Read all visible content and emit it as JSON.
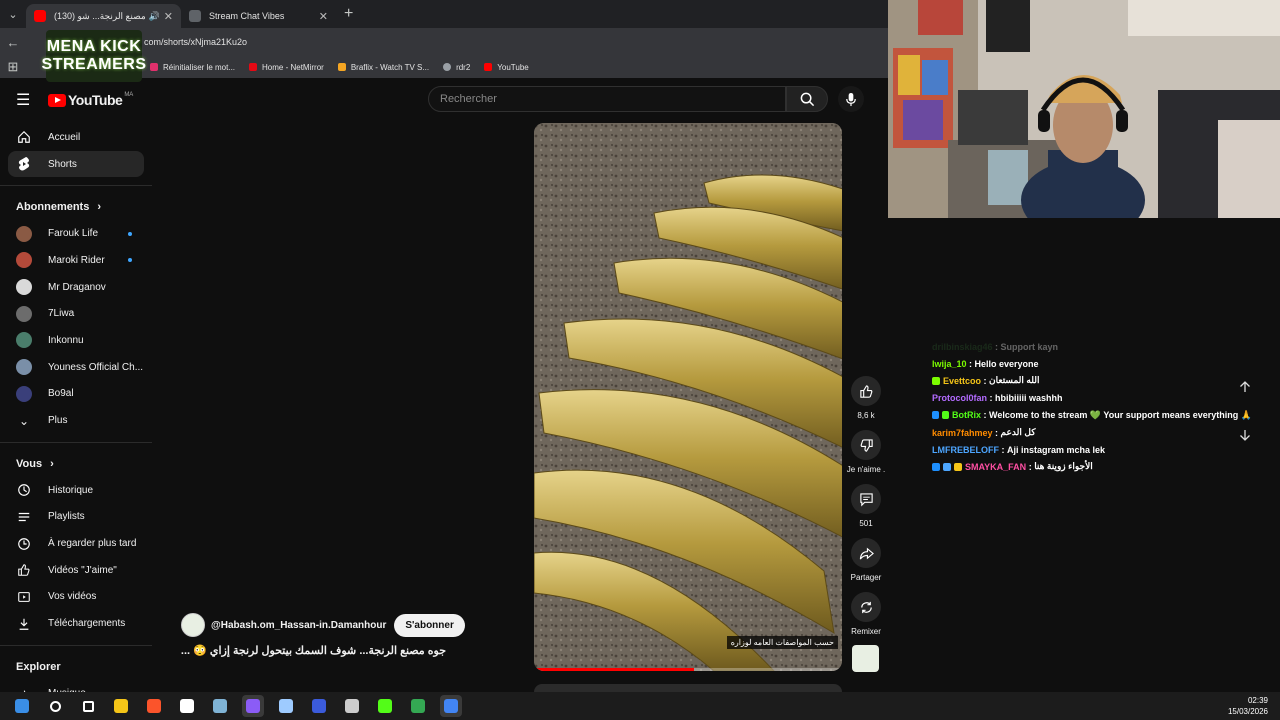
{
  "browser": {
    "tabs": [
      {
        "title": "(130) جوه مصنع الرنجة... شو",
        "active": true,
        "favicon_color": "#ff0000"
      },
      {
        "title": "Stream Chat Vibes",
        "active": false,
        "favicon_color": "#5f6368"
      }
    ],
    "new_tab_label": "+",
    "url": "com/shorts/xNjma21Ku2o",
    "bookmarks": [
      {
        "label": "Réinitialiser le mot...",
        "color": "#e1306c"
      },
      {
        "label": "Home - NetMirror",
        "color": "#e50914"
      },
      {
        "label": "Braflix - Watch TV S...",
        "color": "#f5a623"
      },
      {
        "label": "rdr2",
        "color": "#9aa0a6"
      },
      {
        "label": "YouTube",
        "color": "#ff0000"
      }
    ]
  },
  "overlay_logo": {
    "line1": "MENA KICK",
    "line2": "STREAMERS"
  },
  "youtube": {
    "logo_text": "YouTube",
    "country_code": "MA",
    "search_placeholder": "Rechercher"
  },
  "sidebar": {
    "main_items": [
      {
        "label": "Accueil",
        "icon": "home-icon",
        "active": false
      },
      {
        "label": "Shorts",
        "icon": "shorts-icon",
        "active": true
      }
    ],
    "subscriptions_title": "Abonnements",
    "subscriptions": [
      {
        "label": "Farouk Life",
        "avatar_color": "#8a5a44",
        "new": true
      },
      {
        "label": "Maroki Rider",
        "avatar_color": "#b44a3a",
        "new": true
      },
      {
        "label": "Mr Draganov",
        "avatar_color": "#d9d9d9",
        "new": false
      },
      {
        "label": "7Liwa",
        "avatar_color": "#6c6c6c",
        "new": false
      },
      {
        "label": "Inkonnu",
        "avatar_color": "#4a7d6b",
        "new": false
      },
      {
        "label": "Youness Official Ch...",
        "avatar_color": "#7a8fa8",
        "new": false
      },
      {
        "label": "Bo9al",
        "avatar_color": "#3a3f7a",
        "new": false
      },
      {
        "label": "Plus",
        "icon": "chevron-down-icon"
      }
    ],
    "you_title": "Vous",
    "you_items": [
      {
        "label": "Historique",
        "icon": "history-icon"
      },
      {
        "label": "Playlists",
        "icon": "playlists-icon"
      },
      {
        "label": "À regarder plus tard",
        "icon": "watch-later-icon"
      },
      {
        "label": "Vidéos \"J'aime\"",
        "icon": "like-icon"
      },
      {
        "label": "Vos vidéos",
        "icon": "your-videos-icon"
      },
      {
        "label": "Téléchargements",
        "icon": "download-icon"
      }
    ],
    "explore_title": "Explorer",
    "explore_items": [
      {
        "label": "Musique",
        "icon": "music-icon"
      }
    ]
  },
  "short": {
    "channel": "@Habash.om_Hassan-in.Damanhour",
    "subscribe_label": "S'abonner",
    "title": "جوه مصنع الرنجة... شوف السمك بيتحول لرنجة إزاي 😳 ...",
    "caption": "حسب المواصفات العامه لوزاره",
    "progress_fraction": 0.52,
    "actions": [
      {
        "label": "8,6 k",
        "icon": "thumbs-up-icon"
      },
      {
        "label": "Je n'aime .",
        "icon": "thumbs-down-icon"
      },
      {
        "label": "501",
        "icon": "comment-icon"
      },
      {
        "label": "Partager",
        "icon": "share-icon"
      },
      {
        "label": "Remixer",
        "icon": "remix-icon"
      }
    ]
  },
  "chat": {
    "messages": [
      {
        "user": "drilbinskiag46",
        "text": "Support kayn",
        "color": "#2d5a2d",
        "faded": true,
        "badges": []
      },
      {
        "user": "lwija_10",
        "text": "Hello everyone",
        "color": "#7cfc00",
        "faded": false,
        "badges": []
      },
      {
        "user": "Evettcoo",
        "text": "الله المستعان",
        "color": "#f5c518",
        "faded": false,
        "badges": [
          "#7cfc00"
        ]
      },
      {
        "user": "Protocol0fan",
        "text": "hbibiiiii washhh",
        "color": "#b36bff",
        "faded": false,
        "badges": []
      },
      {
        "user": "BotRix",
        "text": "Welcome to the stream 💚 Your support means everything 🙏",
        "color": "#53fc18",
        "faded": false,
        "badges": [
          "#1e90ff",
          "#53fc18"
        ]
      },
      {
        "user": "karim7fahmey",
        "text": "كل الدعم",
        "color": "#ff8c00",
        "faded": false,
        "badges": []
      },
      {
        "user": "LMFREBELOFF",
        "text": "Aji instagram mcha lek",
        "color": "#4da6ff",
        "faded": false,
        "badges": []
      },
      {
        "user": "SMAYKA_FAN",
        "text": "الأجواء زوينة هنا",
        "color": "#ff4fa3",
        "faded": false,
        "badges": [
          "#1e90ff",
          "#4da6ff",
          "#f5c518"
        ]
      }
    ]
  },
  "taskbar": {
    "time": "02:39",
    "date": "15/03/2026",
    "apps": [
      {
        "name": "windows-start-icon",
        "color": "#3a8ee6"
      },
      {
        "name": "search-icon",
        "color": "#ffffff"
      },
      {
        "name": "task-view-icon",
        "color": "#ffffff"
      },
      {
        "name": "file-explorer-icon",
        "color": "#f5c518"
      },
      {
        "name": "brave-icon",
        "color": "#fb542b"
      },
      {
        "name": "store-icon",
        "color": "#ffffff"
      },
      {
        "name": "app-icon",
        "color": "#7fb3d5"
      },
      {
        "name": "discord-icon",
        "color": "#8b5cf6"
      },
      {
        "name": "notepad-icon",
        "color": "#9ecbff"
      },
      {
        "name": "app-blue-icon",
        "color": "#3b5bdb"
      },
      {
        "name": "obs-icon",
        "color": "#cccccc"
      },
      {
        "name": "kick-icon",
        "color": "#53fc18"
      },
      {
        "name": "chrome-icon",
        "color": "#34a853"
      },
      {
        "name": "chrome-active-icon",
        "color": "#4285f4"
      }
    ]
  }
}
